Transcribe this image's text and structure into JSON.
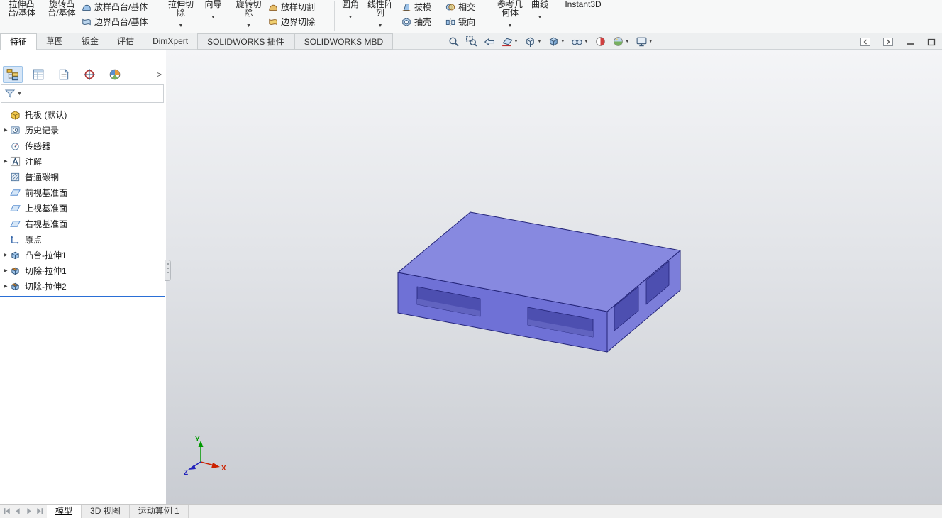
{
  "ribbon": {
    "items": [
      {
        "l1": "拉伸凸",
        "l2": "台/基体"
      },
      {
        "l1": "旋转凸",
        "l2": "台/基体"
      },
      {
        "l1": "放样凸台/基体"
      },
      {
        "l1": "边界凸台/基体"
      },
      {
        "l1": "拉伸切",
        "l2": "除"
      },
      {
        "l1": "向导"
      },
      {
        "l1": "旋转切",
        "l2": "除"
      },
      {
        "l1": "放样切割"
      },
      {
        "l1": "边界切除"
      },
      {
        "l1": "圆角"
      },
      {
        "l1": "线性阵",
        "l2": "列"
      },
      {
        "l1": "拔模"
      },
      {
        "l1": "抽壳"
      },
      {
        "l1": "相交"
      },
      {
        "l1": "镜向"
      },
      {
        "l1": "参考几",
        "l2": "何体"
      },
      {
        "l1": "曲线"
      },
      {
        "l1": "Instant3D"
      }
    ]
  },
  "command_tabs": {
    "items": [
      "特征",
      "草图",
      "钣金",
      "评估",
      "DimXpert",
      "SOLIDWORKS 插件",
      "SOLIDWORKS MBD"
    ],
    "active": "特征"
  },
  "headsup_icons": [
    "zoom-to-fit",
    "zoom-to-area",
    "previous-view",
    "section-view",
    "view-orientation",
    "display-style",
    "hide-show-items",
    "edit-appearance",
    "apply-scene",
    "view-settings"
  ],
  "feature_panel": {
    "tab_icons": [
      "feature-manager-tree",
      "property-manager",
      "configuration-manager",
      "dimxpert-manager",
      "display-manager"
    ],
    "filter_placeholder": ""
  },
  "feature_tree": {
    "root_label": "托板 (默认)",
    "items": [
      {
        "label": "历史记录"
      },
      {
        "label": "传感器"
      },
      {
        "label": "注解"
      },
      {
        "label": "普通碳钢"
      },
      {
        "label": "前视基准面"
      },
      {
        "label": "上视基准面"
      },
      {
        "label": "右视基准面"
      },
      {
        "label": "原点"
      },
      {
        "label": "凸台-拉伸1"
      },
      {
        "label": "切除-拉伸1"
      },
      {
        "label": "切除-拉伸2"
      }
    ]
  },
  "viewport": {
    "triad": {
      "x": "X",
      "y": "Y",
      "z": "Z"
    }
  },
  "bottom_tabs": {
    "items": [
      "模型",
      "3D 视图",
      "运动算例 1"
    ],
    "active": "模型"
  },
  "colors": {
    "model_top": "#8789e0",
    "model_front": "#6f71d6",
    "model_right": "#7c7eda",
    "model_hole": "#4d4fb0",
    "model_hole_floor": "#6163c0",
    "model_edge": "#232478",
    "rollback_bar": "#2a6fd6",
    "triad_x": "#cc2200",
    "triad_y": "#009900",
    "triad_z": "#2222bb"
  }
}
